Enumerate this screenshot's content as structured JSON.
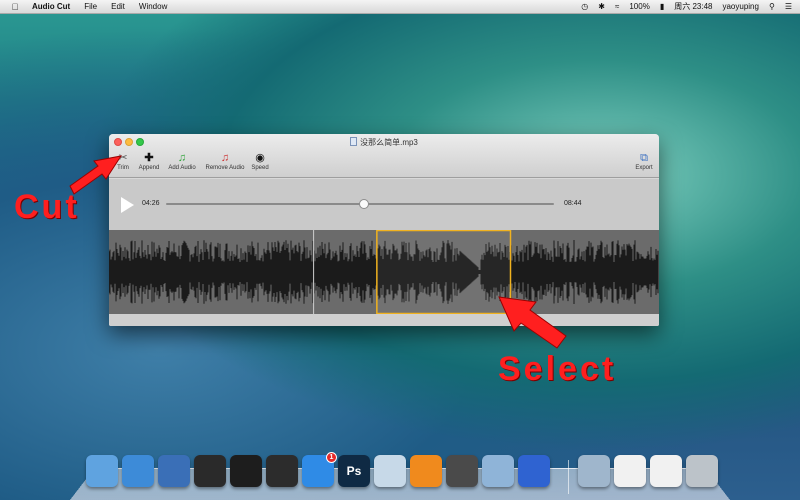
{
  "menubar": {
    "app_name": "Audio Cut",
    "menus": [
      "File",
      "Edit",
      "Window"
    ],
    "battery": "100%",
    "datetime": "周六 23:48",
    "user": "yaoyuping"
  },
  "window": {
    "title": "没那么简单.mp3",
    "toolbar": {
      "trim": "Trim",
      "append": "Append",
      "add_audio": "Add Audio",
      "remove_audio": "Remove Audio",
      "speed": "Speed",
      "export": "Export"
    },
    "player": {
      "current_time": "04:26",
      "total_time": "08:44",
      "progress": 0.51
    },
    "selection": {
      "start_fraction": 0.487,
      "end_fraction": 0.73
    },
    "playhead_fraction": 0.372
  },
  "annotations": {
    "cut": "Cut",
    "select": "Select",
    "color": "#ff1f1f"
  },
  "dock": {
    "items": [
      {
        "name": "finder-icon",
        "color": "#5fa3e0"
      },
      {
        "name": "safari-icon",
        "color": "#3d8bd8"
      },
      {
        "name": "xcode-icon",
        "color": "#3a6fb7"
      },
      {
        "name": "console-icon",
        "color": "#2a2a2a"
      },
      {
        "name": "terminal-icon",
        "color": "#1d1d1d"
      },
      {
        "name": "activity-monitor-icon",
        "color": "#2c2c2c"
      },
      {
        "name": "app-store-icon",
        "color": "#2f8be6",
        "badge": "1"
      },
      {
        "name": "photoshop-icon",
        "color": "#0f2a44",
        "label": "Ps"
      },
      {
        "name": "preview-icon",
        "color": "#c7d9e8"
      },
      {
        "name": "ibooks-icon",
        "color": "#f08a1d"
      },
      {
        "name": "photo-booth-icon",
        "color": "#4a4a4a"
      },
      {
        "name": "mail-icon",
        "color": "#8fb4d8"
      },
      {
        "name": "itunes-icon",
        "color": "#2f63d1"
      }
    ],
    "stack_items": [
      {
        "name": "applications-folder-icon",
        "color": "#9fb6cc"
      },
      {
        "name": "documents-stack-icon",
        "color": "#f1f1f1"
      },
      {
        "name": "downloads-stack-icon",
        "color": "#f1f1f1"
      },
      {
        "name": "trash-icon",
        "color": "#bcc3c9"
      }
    ]
  }
}
